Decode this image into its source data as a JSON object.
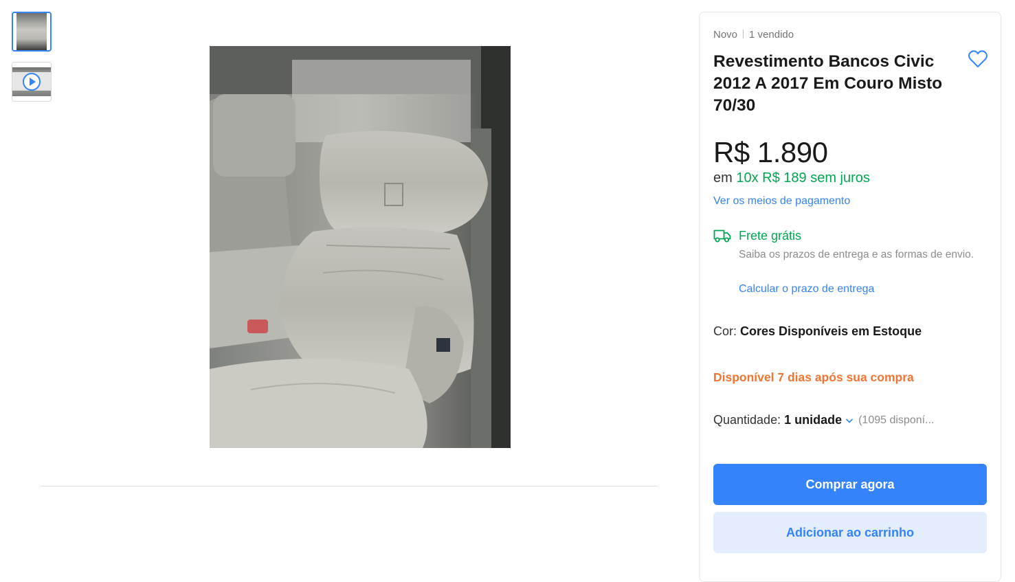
{
  "gallery": {
    "thumbnails": [
      {
        "icon": "seat-photo-thumbnail",
        "selected": true
      },
      {
        "icon": "video-play-icon",
        "selected": false
      }
    ]
  },
  "product": {
    "condition": "Novo",
    "sold": "1 vendido",
    "title": "Revestimento Bancos Civic 2012 A 2017 Em Couro Misto 70/30",
    "price": "R$ 1.890",
    "installments_prefix": "em",
    "installments": "10x R$ 189 sem juros",
    "payment_link": "Ver os meios de pagamento",
    "favorite_icon": "heart-outline-icon"
  },
  "shipping": {
    "icon": "truck-icon",
    "title": "Frete grátis",
    "description": "Saiba os prazos de entrega e as formas de envio.",
    "link": "Calcular o prazo de entrega"
  },
  "color": {
    "label": "Cor:",
    "value": "Cores Disponíveis em Estoque"
  },
  "availability": "Disponível 7 dias após sua compra",
  "quantity": {
    "label": "Quantidade:",
    "value": "1 unidade",
    "stock": "(1095 disponí..."
  },
  "actions": {
    "buy_now": "Comprar agora",
    "add_to_cart": "Adicionar ao carrinho"
  },
  "colors": {
    "accent": "#3483fa",
    "success": "#00a650",
    "warning": "#f27433"
  }
}
